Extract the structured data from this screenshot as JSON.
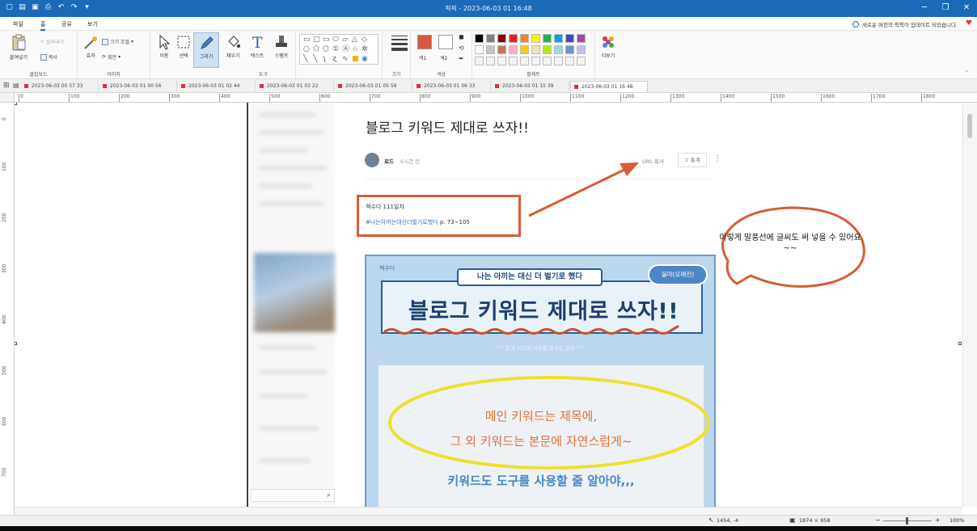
{
  "window": {
    "title": "픽픽 - 2023-06-03 01 16:48",
    "controls": [
      "─",
      "❐",
      "✕"
    ]
  },
  "menu": {
    "tabs": [
      "파일",
      "홈",
      "공유",
      "보기"
    ],
    "notice": "새로운 버전의 픽픽이 업데이트 되었습니다."
  },
  "ribbon": {
    "clipboard": {
      "paste": "붙여넣기",
      "cut": "잘라내기",
      "copy": "복사",
      "group": "클립보드"
    },
    "image": {
      "effects": "효과",
      "resize": "크기 조절",
      "rotate": "회전",
      "group": "이미지"
    },
    "tools": {
      "move": "이동",
      "select": "선택",
      "draw": "그리기",
      "fill": "채우기",
      "text": "텍스트",
      "stamp": "스탬프",
      "group": "도구"
    },
    "size": {
      "label": "크기"
    },
    "color": {
      "color1": "색1",
      "color2": "색2",
      "group": "색상"
    },
    "palette": {
      "group": "팔레트",
      "more": "더보기"
    },
    "palette_colors": [
      "#000000",
      "#7f7f7f",
      "#880015",
      "#ed1c24",
      "#ff7f27",
      "#fff200",
      "#22b14c",
      "#00a2e8",
      "#3f48cc",
      "#a349a4",
      "#ffffff",
      "#c3c3c3",
      "#b97a57",
      "#ffaec9",
      "#ffc90e",
      "#efe4b0",
      "#b5e61d",
      "#99d9ea",
      "#7092be",
      "#c8bfe7"
    ]
  },
  "doc_tabs": [
    "2023-06-03 00 57 33",
    "2023-06-03 01 00 56",
    "2023-06-03 01 02 44",
    "2023-06-03 01 03 22",
    "2023-06-03 01 05 59",
    "2023-06-03 01 06 33",
    "2023-06-03 01 15 39",
    "2023-06-03 01 16 48"
  ],
  "ruler": {
    "h_ticks": [
      "0",
      "100",
      "200",
      "300",
      "400",
      "500",
      "600",
      "700",
      "800",
      "900",
      "1000",
      "1100",
      "1200",
      "1300",
      "1400",
      "1500",
      "1600",
      "1700",
      "1800"
    ],
    "v_ticks": [
      "0",
      "100",
      "200",
      "300",
      "400",
      "500",
      "600",
      "700"
    ]
  },
  "post": {
    "title": "블로그 키워드 제대로 쓰자!!",
    "author": "로드",
    "time": "6시간 전",
    "url_copy": "URL 복사",
    "share": "⇪ 통계",
    "more": "⋮",
    "line1": "책수다 111일차",
    "line2_tag": "#나는아끼는대신더벌기로했다",
    "line2_page": "p. 73~105"
  },
  "bubble": {
    "text": "이렇게 말풍선에 글씨도 써 넣을 수 있어요~~"
  },
  "card": {
    "tag": "책수다",
    "subtitle": "나는 아끼는 대신 더 벌기로 했다",
    "author_pill": "울마(오매진)",
    "main_title": "블로그 키워드 제대로 쓰자!!",
    "tagline": "^^ 돈과 시간의 자유를 꿈꾸는 일상 ^^",
    "k1": "메인 키워드는 제목에,",
    "k2": "그 외 키워드는 본문에 자연스럽게~",
    "k3": "키워드도 도구를 사용할 줄 알아야,,,"
  },
  "status": {
    "position": "1454, -4",
    "dimensions": "1874 × 958",
    "zoom": "100%"
  },
  "colors": {
    "titlebar": "#1a6ab8",
    "annotation_red": "#d75d33",
    "annotation_yellow": "#efe12f"
  }
}
